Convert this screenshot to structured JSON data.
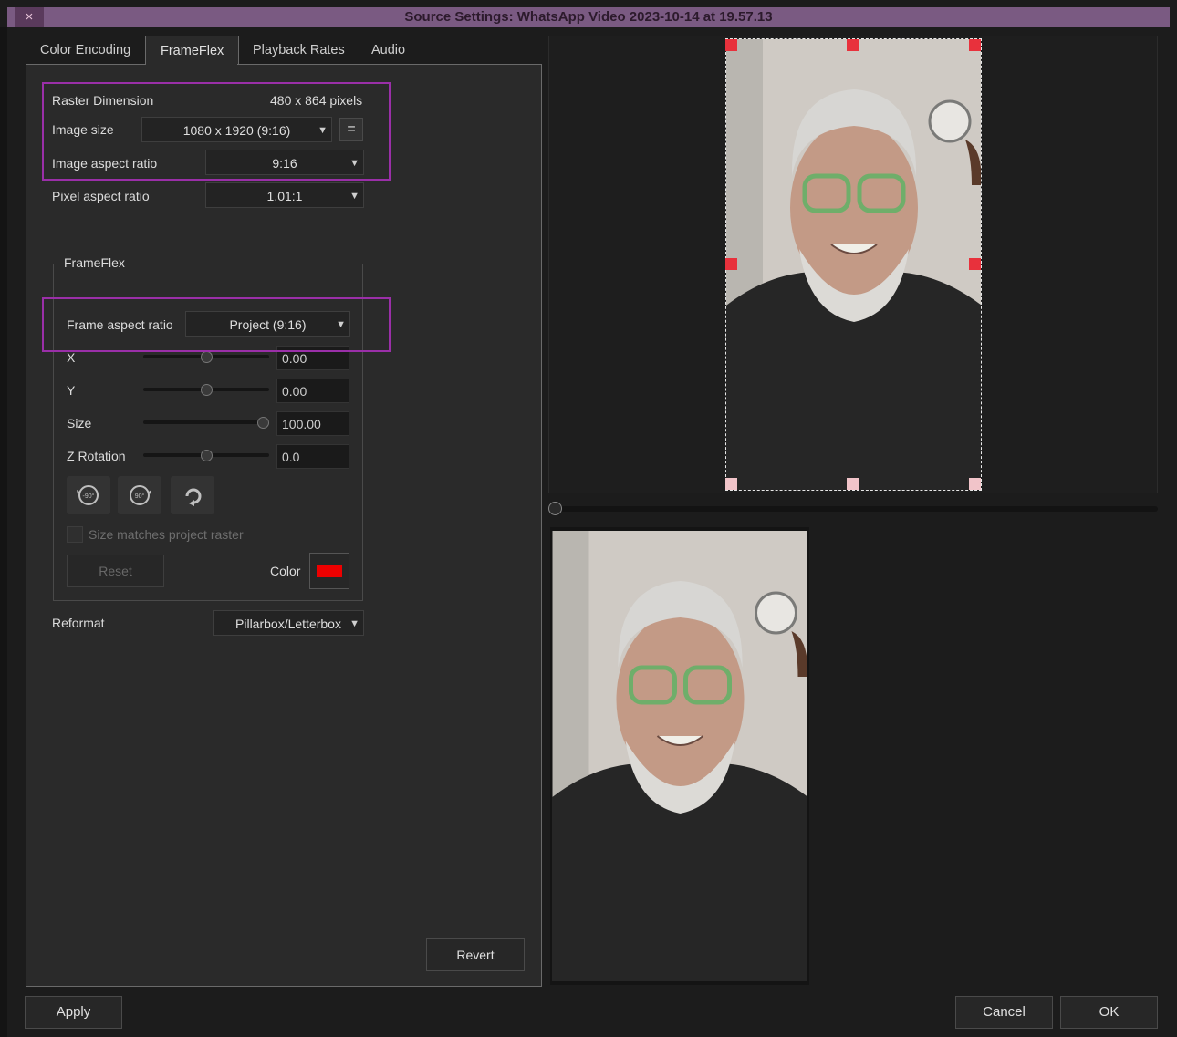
{
  "window": {
    "title": "Source Settings: WhatsApp Video 2023-10-14 at 19.57.13",
    "close_icon": "×"
  },
  "tabs": [
    {
      "label": "Color Encoding",
      "active": false
    },
    {
      "label": "FrameFlex",
      "active": true
    },
    {
      "label": "Playback Rates",
      "active": false
    },
    {
      "label": "Audio",
      "active": false
    }
  ],
  "raster": {
    "label": "Raster Dimension",
    "value": "480 x 864 pixels",
    "image_size_label": "Image size",
    "image_size_value": "1080 x 1920 (9:16)",
    "link_icon": "=",
    "image_aspect_label": "Image aspect ratio",
    "image_aspect_value": "9:16",
    "pixel_aspect_label": "Pixel aspect ratio",
    "pixel_aspect_value": "1.01:1"
  },
  "frameflex": {
    "group_label": "FrameFlex",
    "frame_aspect_label": "Frame aspect ratio",
    "frame_aspect_value": "Project (9:16)",
    "x_label": "X",
    "x_value": "0.00",
    "x_pos": 0.5,
    "y_label": "Y",
    "y_value": "0.00",
    "y_pos": 0.5,
    "size_label": "Size",
    "size_value": "100.00",
    "size_pos": 0.95,
    "zrot_label": "Z Rotation",
    "zrot_value": "0.0",
    "zrot_pos": 0.5,
    "rotate_left_text": "-90°",
    "rotate_right_text": "90°",
    "size_matches_label": "Size matches project raster",
    "size_matches_checked": false,
    "reset_label": "Reset",
    "color_label": "Color",
    "color_value": "#ee0000"
  },
  "reformat": {
    "label": "Reformat",
    "value": "Pillarbox/Letterbox"
  },
  "buttons": {
    "revert": "Revert",
    "apply": "Apply",
    "cancel": "Cancel",
    "ok": "OK"
  },
  "dropdown_arrow": "▼",
  "accent": {
    "highlight": "#9a2fa8",
    "handle": "#e8313c"
  }
}
